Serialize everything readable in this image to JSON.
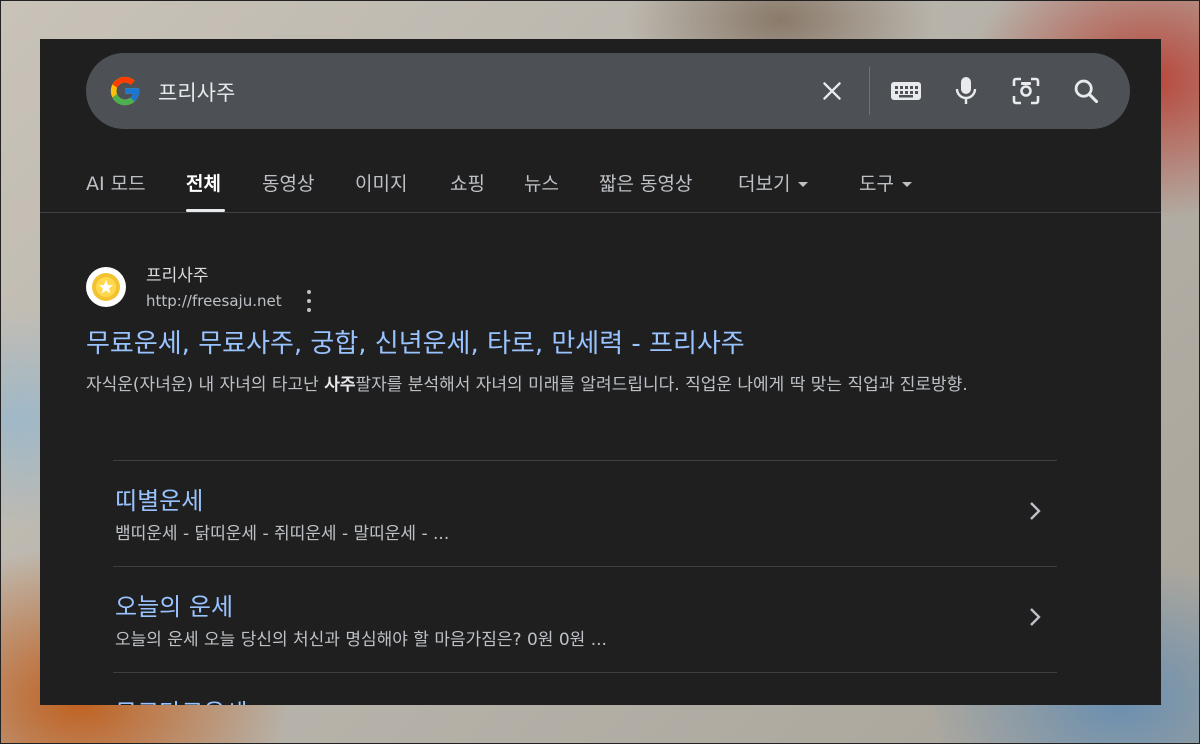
{
  "search": {
    "query": "프리사주",
    "icons": [
      "google-g-icon",
      "clear-icon",
      "keyboard-icon",
      "mic-icon",
      "lens-icon",
      "search-icon"
    ]
  },
  "tabs": [
    {
      "label": "AI 모드"
    },
    {
      "label": "전체"
    },
    {
      "label": "동영상"
    },
    {
      "label": "이미지"
    },
    {
      "label": "쇼핑"
    },
    {
      "label": "뉴스"
    },
    {
      "label": "짧은 동영상"
    },
    {
      "label": "더보기"
    },
    {
      "label": "도구"
    }
  ],
  "result": {
    "site_name": "프리사주",
    "url": "http://freesaju.net",
    "title": "무료운세, 무료사주, 궁합, 신년운세, 타로, 만세력 - 프리사주",
    "snippet_before": "자식운(자녀운) 내 자녀의 타고난 ",
    "snippet_bold": "사주",
    "snippet_after": "팔자를 분석해서 자녀의 미래를 알려드립니다. 직업운 나에게 딱 맞는 직업과 진로방향."
  },
  "sitelinks": [
    {
      "title": "띠별운세",
      "desc": "뱀띠운세 - 닭띠운세 - 쥐띠운세 - 말띠운세 - ..."
    },
    {
      "title": "오늘의 운세",
      "desc": "오늘의 운세 오늘 당신의 처신과 명심해야 할 마음가짐은? 0원 0원 ..."
    },
    {
      "title": "무료타로운세",
      "desc": ""
    }
  ],
  "colors": {
    "background": "#1f1f1f",
    "link": "#99c3ff",
    "text": "#bdc1c6",
    "searchbar": "#4d5156"
  }
}
